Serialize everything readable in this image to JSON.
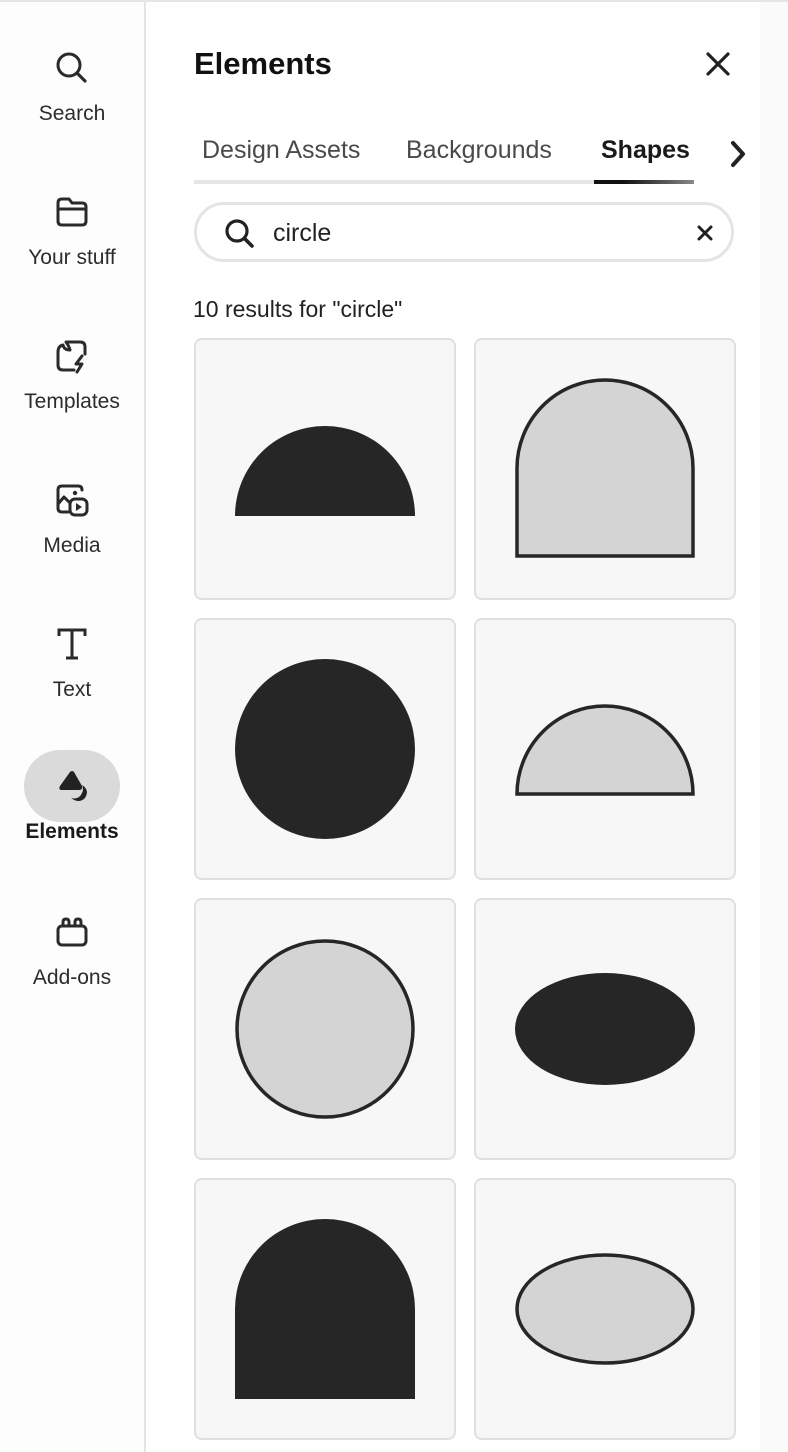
{
  "rail": {
    "items": [
      {
        "label": "Search",
        "icon": "search-icon",
        "active": false
      },
      {
        "label": "Your stuff",
        "icon": "folder-icon",
        "active": false
      },
      {
        "label": "Templates",
        "icon": "templates-icon",
        "active": false
      },
      {
        "label": "Media",
        "icon": "media-icon",
        "active": false
      },
      {
        "label": "Text",
        "icon": "text-icon",
        "active": false
      },
      {
        "label": "Elements",
        "icon": "elements-icon",
        "active": true
      },
      {
        "label": "Add-ons",
        "icon": "add-ons-icon",
        "active": false
      }
    ]
  },
  "panel": {
    "title": "Elements",
    "close_icon": "close-icon",
    "tabs": [
      {
        "label": "Design Assets",
        "active": false
      },
      {
        "label": "Backgrounds",
        "active": false
      },
      {
        "label": "Shapes",
        "active": true
      }
    ],
    "next_icon": "chevron-right-icon",
    "search": {
      "value": "circle",
      "placeholder": "",
      "icon": "search-icon",
      "clear_icon": "clear-icon"
    },
    "results_label": "10 results for \"circle\"",
    "results": [
      {
        "shape": "half-circle",
        "style": "filled",
        "fill": "#262626"
      },
      {
        "shape": "arch",
        "style": "outlined",
        "fill": "#d4d4d4",
        "stroke": "#262626"
      },
      {
        "shape": "circle",
        "style": "filled",
        "fill": "#262626"
      },
      {
        "shape": "half-circle",
        "style": "outlined",
        "fill": "#d4d4d4",
        "stroke": "#262626"
      },
      {
        "shape": "circle",
        "style": "outlined",
        "fill": "#d4d4d4",
        "stroke": "#262626"
      },
      {
        "shape": "ellipse",
        "style": "filled",
        "fill": "#262626"
      },
      {
        "shape": "arch",
        "style": "filled",
        "fill": "#262626"
      },
      {
        "shape": "ellipse",
        "style": "outlined",
        "fill": "#d4d4d4",
        "stroke": "#262626"
      }
    ]
  }
}
